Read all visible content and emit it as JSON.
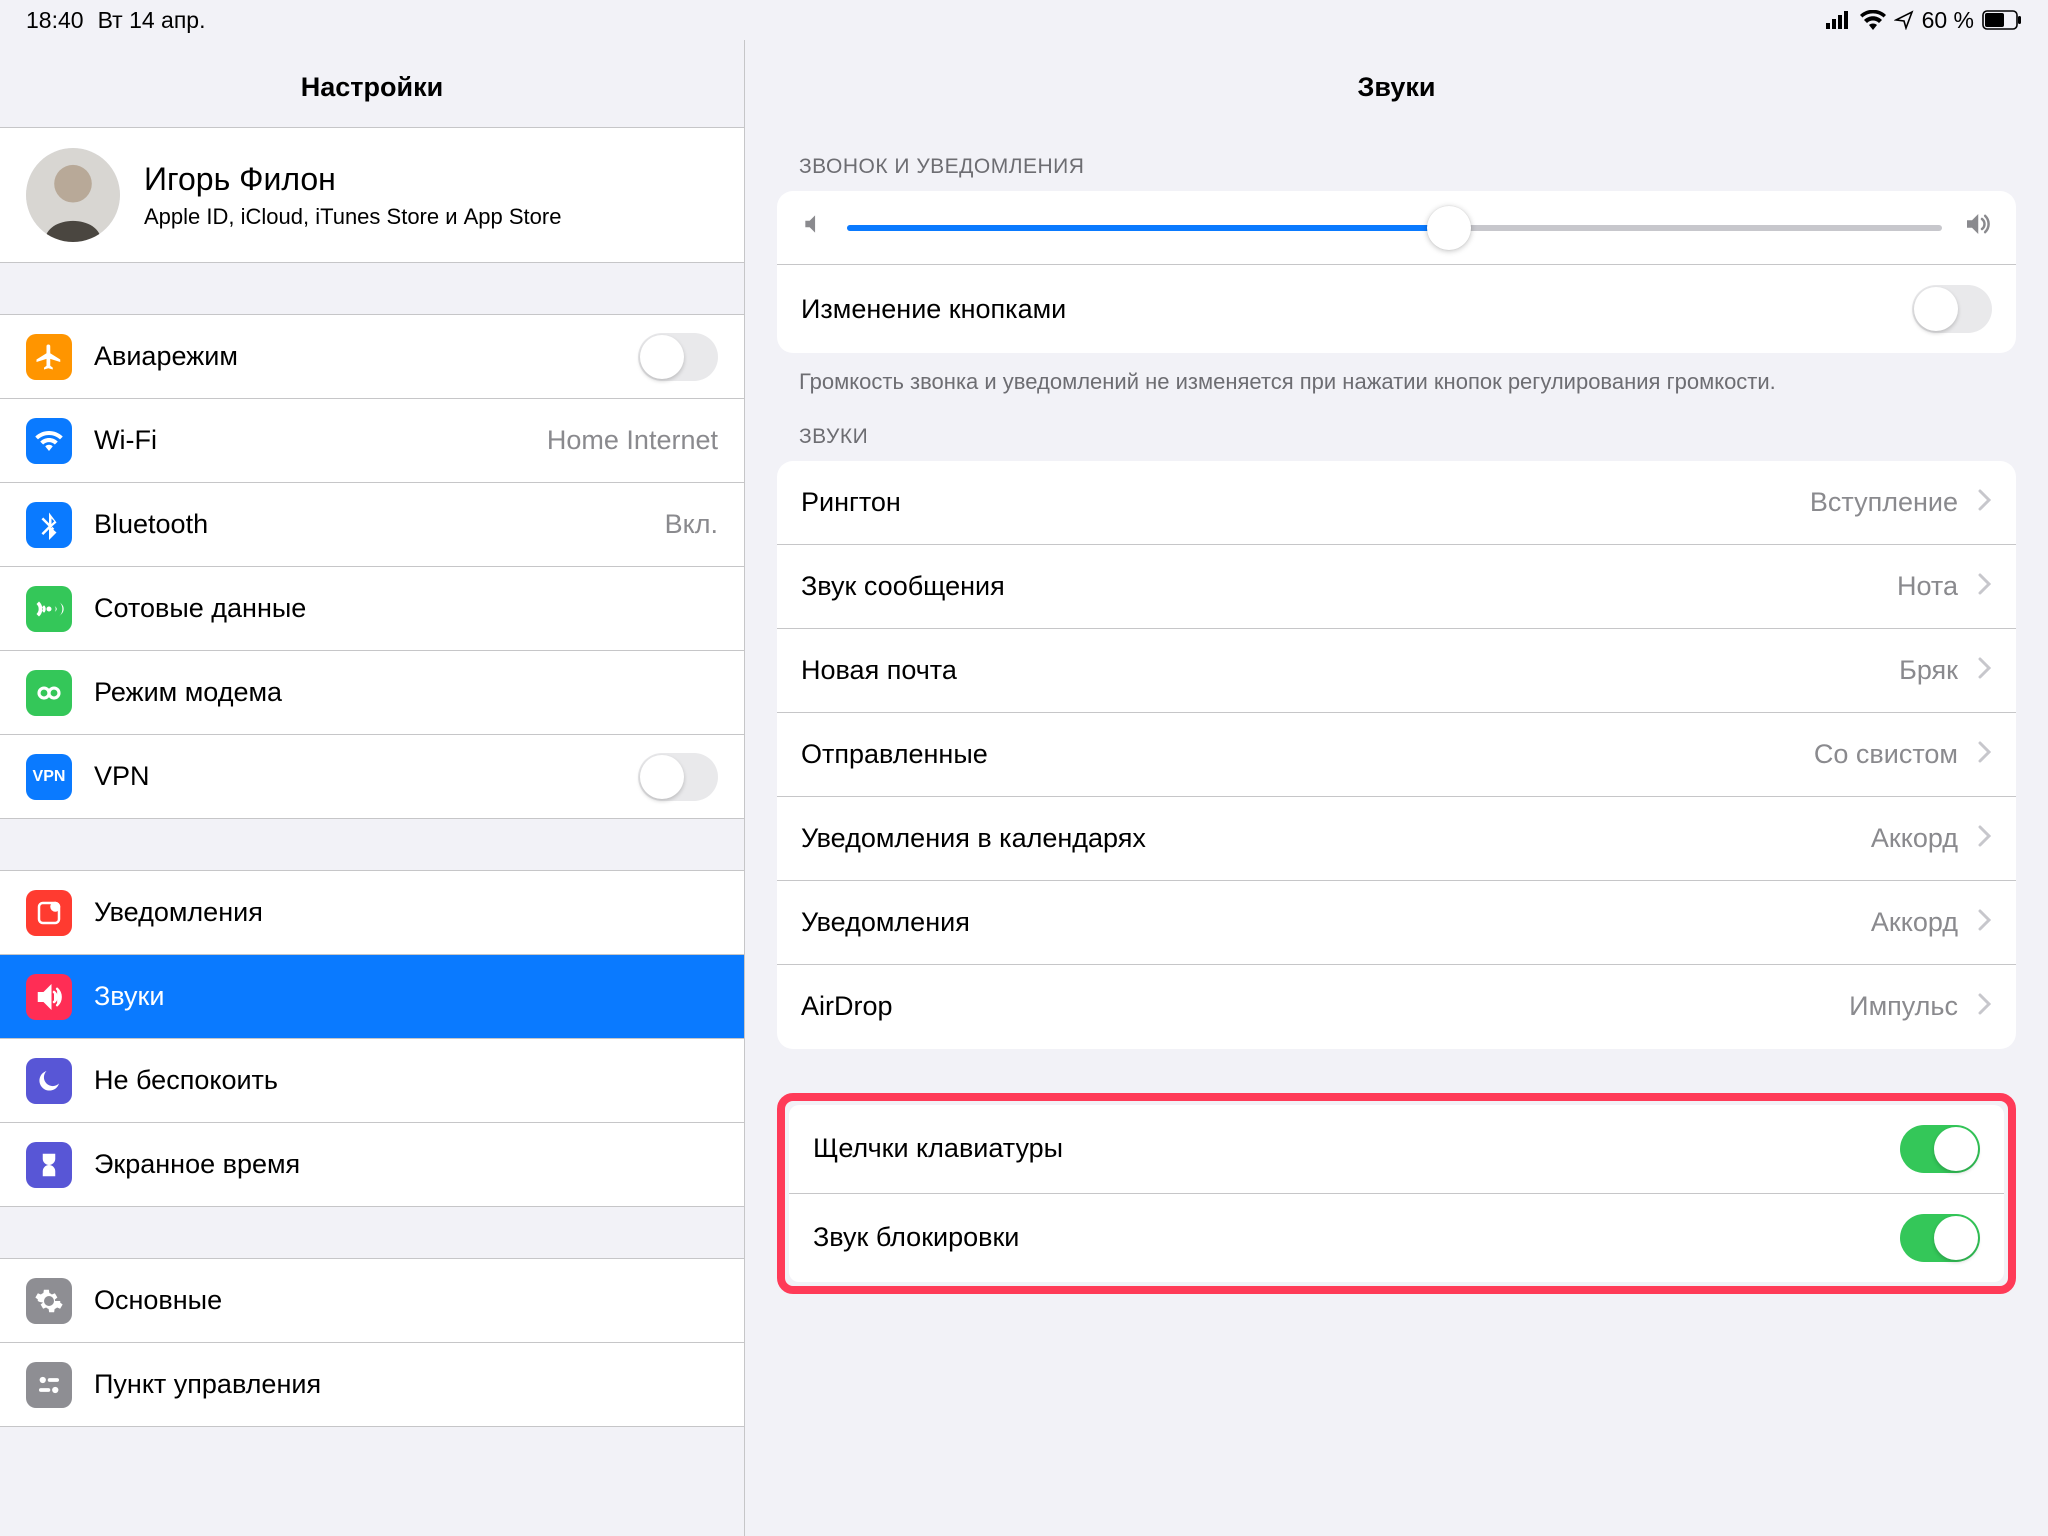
{
  "status": {
    "time": "18:40",
    "date": "Вт 14 апр.",
    "battery_pct": "60 %"
  },
  "sidebar": {
    "title": "Настройки",
    "account": {
      "name": "Игорь Филон",
      "sub": "Apple ID, iCloud, iTunes Store и App Store"
    },
    "g1": {
      "airplane": "Авиарежим",
      "wifi": "Wi-Fi",
      "wifi_value": "Home Internet",
      "bluetooth": "Bluetooth",
      "bluetooth_value": "Вкл.",
      "cellular": "Сотовые данные",
      "hotspot": "Режим модема",
      "vpn": "VPN"
    },
    "g2": {
      "notifications": "Уведомления",
      "sounds": "Звуки",
      "dnd": "Не беспокоить",
      "screentime": "Экранное время"
    },
    "g3": {
      "general": "Основные",
      "controlcenter": "Пункт управления"
    }
  },
  "detail": {
    "title": "Звуки",
    "ringer_header": "ЗВОНОК И УВЕДОМЛЕНИЯ",
    "volume_pct": 55,
    "change_with_buttons": "Изменение кнопками",
    "ringer_footnote": "Громкость звонка и уведомлений не изменяется при нажатии кнопок регулирования громкости.",
    "sounds_header": "ЗВУКИ",
    "rows": {
      "ringtone": "Рингтон",
      "ringtone_v": "Вступление",
      "text": "Звук сообщения",
      "text_v": "Нота",
      "newmail": "Новая почта",
      "newmail_v": "Бряк",
      "sentmail": "Отправленные",
      "sentmail_v": "Со свистом",
      "calendar": "Уведомления в календарях",
      "calendar_v": "Аккорд",
      "reminders": "Уведомления",
      "reminders_v": "Аккорд",
      "airdrop": "AirDrop",
      "airdrop_v": "Импульс"
    },
    "keyboard_clicks": "Щелчки клавиатуры",
    "lock_sound": "Звук блокировки"
  }
}
